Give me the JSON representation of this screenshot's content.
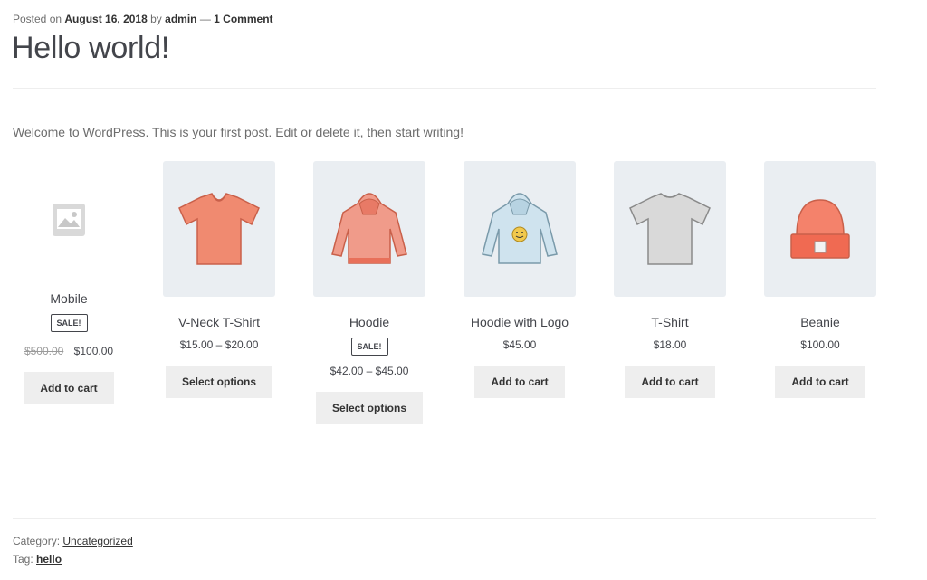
{
  "post": {
    "posted_on": "Posted on",
    "date": "August 16, 2018",
    "by": "by",
    "author": "admin",
    "dash": "—",
    "comments": "1 Comment",
    "title": "Hello world!",
    "intro": "Welcome to WordPress. This is your first post. Edit or delete it, then start writing!"
  },
  "products": [
    {
      "name": "Mobile",
      "sale": "SALE!",
      "old_price": "$500.00",
      "price": "$100.00",
      "button": "Add to cart"
    },
    {
      "name": "V-Neck T-Shirt",
      "price": "$15.00 – $20.00",
      "button": "Select options"
    },
    {
      "name": "Hoodie",
      "sale": "SALE!",
      "price": "$42.00 – $45.00",
      "button": "Select options"
    },
    {
      "name": "Hoodie with Logo",
      "price": "$45.00",
      "button": "Add to cart"
    },
    {
      "name": "T-Shirt",
      "price": "$18.00",
      "button": "Add to cart"
    },
    {
      "name": "Beanie",
      "price": "$100.00",
      "button": "Add to cart"
    }
  ],
  "footer": {
    "category_label": "Category:",
    "category": "Uncategorized",
    "tag_label": "Tag:",
    "tag": "hello"
  },
  "colors": {
    "thumb_bg": "#eaeef2",
    "tee_orange": "#f08a70",
    "hoodie_pink": "#f09b8a",
    "hoodie_blue": "#cfe3ee",
    "tee_grey": "#d9d9d9",
    "beanie_orange": "#f4826b"
  }
}
